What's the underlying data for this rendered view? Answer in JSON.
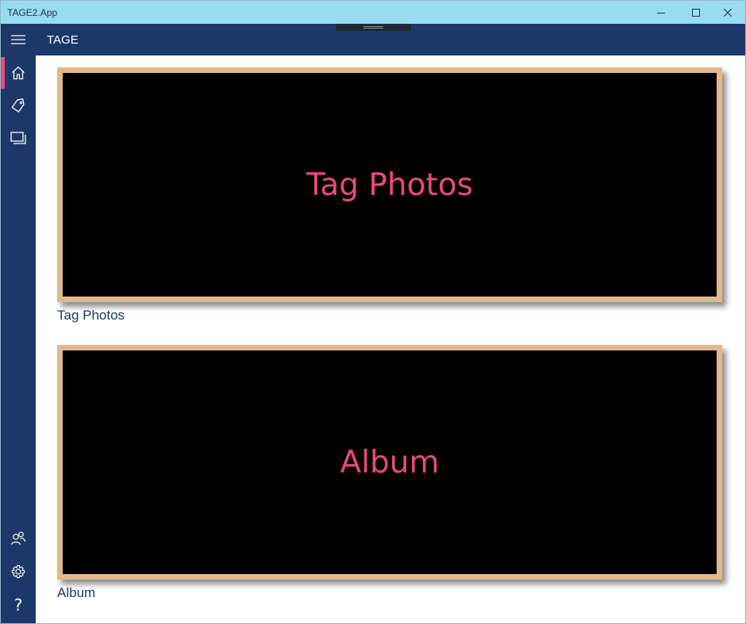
{
  "window": {
    "title": "TAGE2.App",
    "controls": {
      "minimize_icon": "minimize-icon",
      "maximize_icon": "maximize-icon",
      "close_icon": "close-icon"
    }
  },
  "appbar": {
    "title": "TAGE",
    "menu_icon": "hamburger-icon",
    "background": "#1c3869"
  },
  "sidebar": {
    "items": [
      {
        "name": "home",
        "icon": "home-icon",
        "active": true
      },
      {
        "name": "tag",
        "icon": "tag-icon",
        "active": false
      },
      {
        "name": "album",
        "icon": "album-icon",
        "active": false
      }
    ],
    "bottom_items": [
      {
        "name": "people",
        "icon": "people-icon"
      },
      {
        "name": "settings",
        "icon": "gear-icon"
      },
      {
        "name": "help",
        "icon": "help-icon",
        "glyph": "?"
      }
    ],
    "active_color": "#e9487e"
  },
  "main": {
    "tiles": [
      {
        "title": "Tag Photos",
        "caption": "Tag Photos"
      },
      {
        "title": "Album",
        "caption": "Album"
      }
    ],
    "tile_frame_color": "#e1b98a",
    "tile_text_color": "#e9487e"
  }
}
